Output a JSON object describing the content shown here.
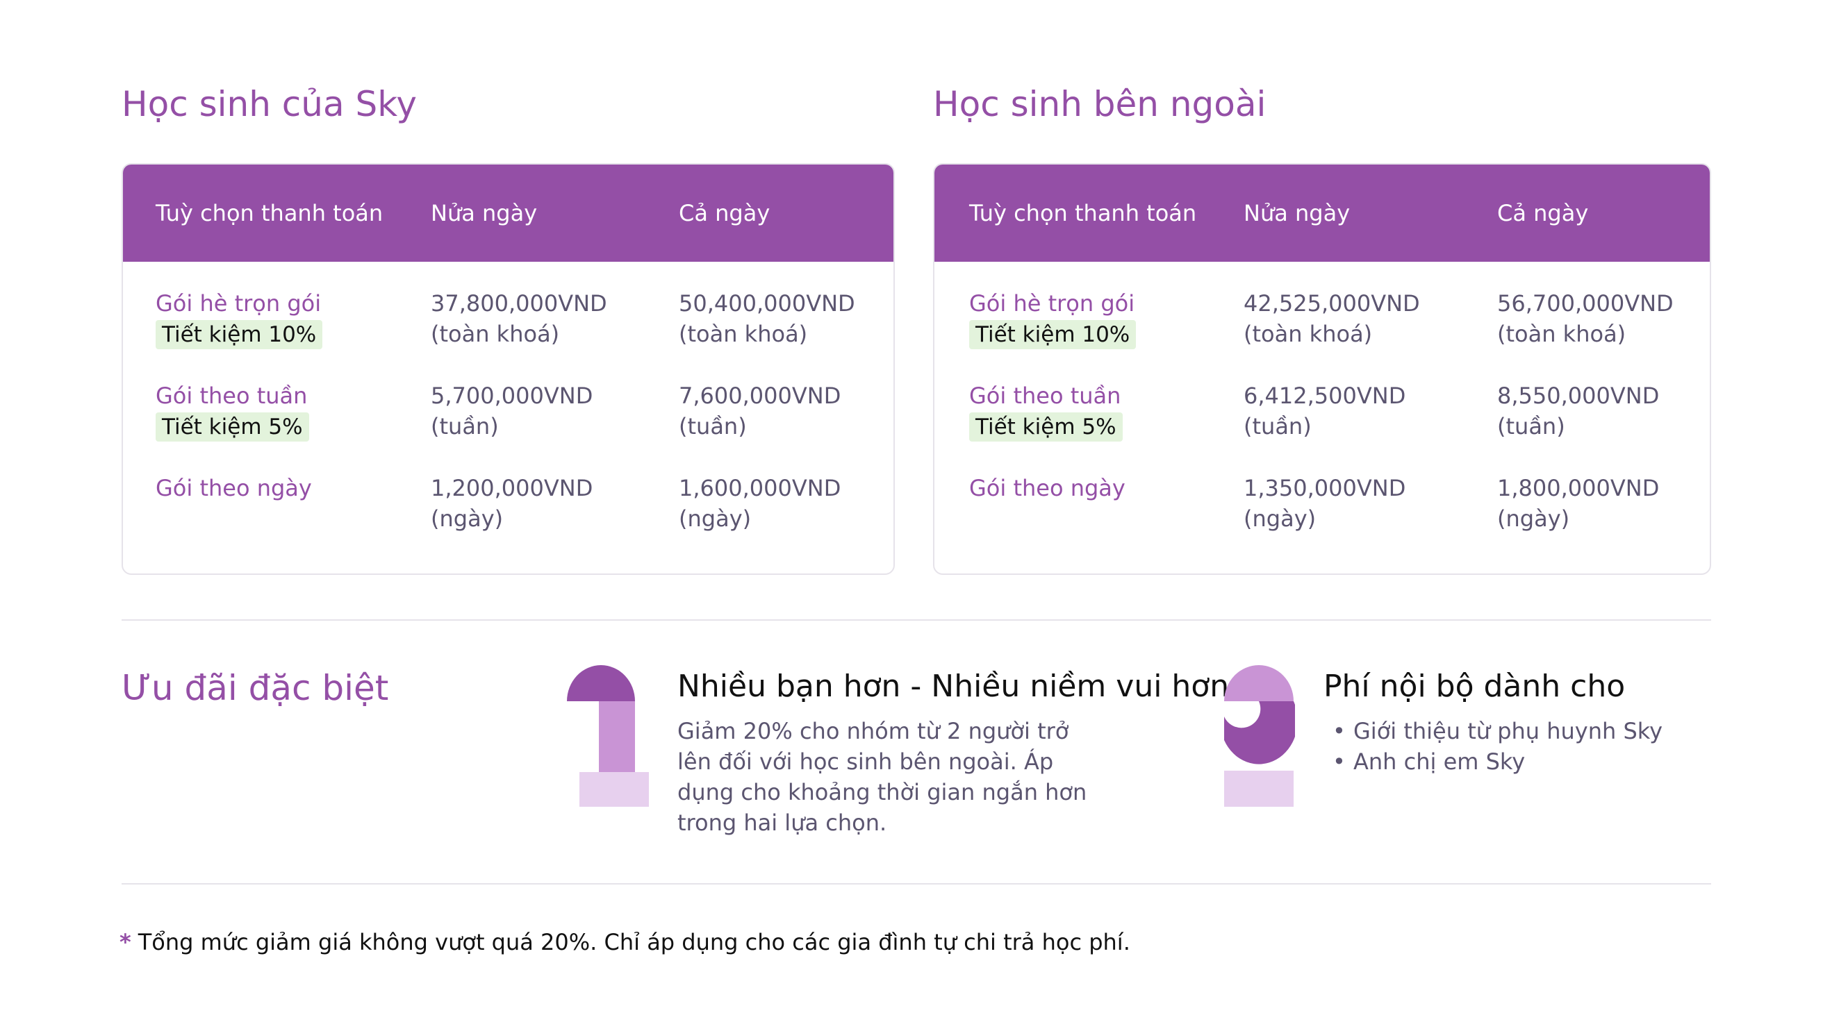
{
  "pricing": {
    "sky_students": {
      "title": "Học sinh của Sky",
      "headers": [
        "Tuỳ chọn thanh toán",
        "Nửa ngày",
        "Cả ngày"
      ],
      "rows": [
        {
          "name": "Gói hè trọn gói",
          "badge": "Tiết kiệm 10%",
          "half_price": "37,800,000VND",
          "half_unit": "(toàn khoá)",
          "full_price": "50,400,000VND",
          "full_unit": "(toàn khoá)"
        },
        {
          "name": "Gói theo tuần",
          "badge": "Tiết kiệm 5%",
          "half_price": "5,700,000VND",
          "half_unit": "(tuần)",
          "full_price": "7,600,000VND",
          "full_unit": "(tuần)"
        },
        {
          "name": "Gói theo ngày",
          "badge": "",
          "half_price": "1,200,000VND",
          "half_unit": "(ngày)",
          "full_price": "1,600,000VND",
          "full_unit": "(ngày)"
        }
      ]
    },
    "outside_students": {
      "title": "Học sinh bên ngoài",
      "headers": [
        "Tuỳ chọn thanh toán",
        "Nửa ngày",
        "Cả ngày"
      ],
      "rows": [
        {
          "name": "Gói hè trọn gói",
          "badge": "Tiết kiệm 10%",
          "half_price": "42,525,000VND",
          "half_unit": "(toàn khoá)",
          "full_price": "56,700,000VND",
          "full_unit": "(toàn khoá)"
        },
        {
          "name": "Gói theo tuần",
          "badge": "Tiết kiệm 5%",
          "half_price": "6,412,500VND",
          "half_unit": "(tuần)",
          "full_price": "8,550,000VND",
          "full_unit": "(tuần)"
        },
        {
          "name": "Gói theo ngày",
          "badge": "",
          "half_price": "1,350,000VND",
          "half_unit": "(ngày)",
          "full_price": "1,800,000VND",
          "full_unit": "(ngày)"
        }
      ]
    }
  },
  "offers": {
    "title": "Ưu đãi đặc biệt",
    "offer1": {
      "number_icon": "number-one-graphic",
      "title": "Nhiều bạn hơn - Nhiều niềm vui hơn",
      "desc_lines": [
        "Giảm 20% cho nhóm từ 2 người trở",
        "lên đối với học sinh bên ngoài. Áp",
        "dụng cho khoảng thời gian ngắn hơn",
        "trong hai lựa chọn."
      ]
    },
    "offer2": {
      "number_icon": "number-two-graphic",
      "title": "Phí nội bộ dành cho",
      "bullet": "•",
      "items": [
        "Giới thiệu từ phụ huynh Sky",
        "Anh chị em Sky"
      ]
    }
  },
  "footnote": {
    "asterisk": "*",
    "text": "Tổng mức giảm giá không vượt quá 20%. Chỉ áp dụng cho các gia đình tự chi trả học phí."
  },
  "colors": {
    "accent_purple": "#944fa6",
    "mid_purple": "#c994d5",
    "light_purple": "#e7d0ee",
    "badge_green": "#e3f3dc",
    "border": "#e6e3ea",
    "text_gray": "#5b5570"
  }
}
